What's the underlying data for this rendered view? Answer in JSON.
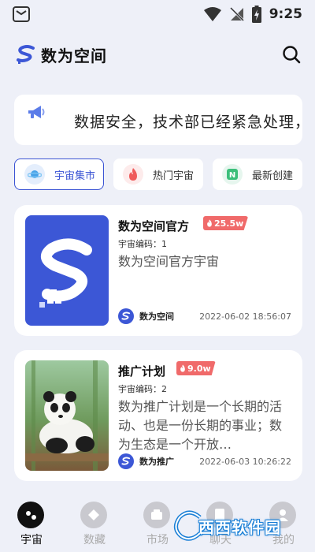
{
  "status_bar": {
    "time": "9:25"
  },
  "header": {
    "title": "数为空间"
  },
  "notice": {
    "text": "数据安全，技术部已经紧急处理，"
  },
  "filters": [
    {
      "label": "宇宙集市",
      "active": true
    },
    {
      "label": "热门宇宙",
      "active": false
    },
    {
      "label": "最新创建",
      "active": false
    }
  ],
  "cards": [
    {
      "title": "数为空间官方",
      "heat": "25.5w",
      "code": "宇宙编码：1",
      "description": "数为空间官方宇宙",
      "author": "数为空间",
      "date": "2022-06-02 18:56:07"
    },
    {
      "title": "推广计划",
      "heat": "9.0w",
      "code": "宇宙编码：2",
      "description": "数为推广计划是一个长期的活动、也是一份长期的事业；数为生态是一个开放…",
      "author": "数为推广",
      "date": "2022-06-03 10:26:22"
    }
  ],
  "tabs": [
    {
      "label": "宇宙",
      "icon": "universe-icon",
      "active": true
    },
    {
      "label": "数藏",
      "icon": "collection-icon",
      "active": false
    },
    {
      "label": "市场",
      "icon": "market-icon",
      "active": false
    },
    {
      "label": "聊天",
      "icon": "chat-icon",
      "active": false
    },
    {
      "label": "我的",
      "icon": "profile-icon",
      "active": false
    }
  ],
  "watermark": {
    "text": "西西软件园"
  },
  "colors": {
    "accent": "#3b54d4",
    "heat": "#f06a6a",
    "background": "#eef0f8"
  }
}
